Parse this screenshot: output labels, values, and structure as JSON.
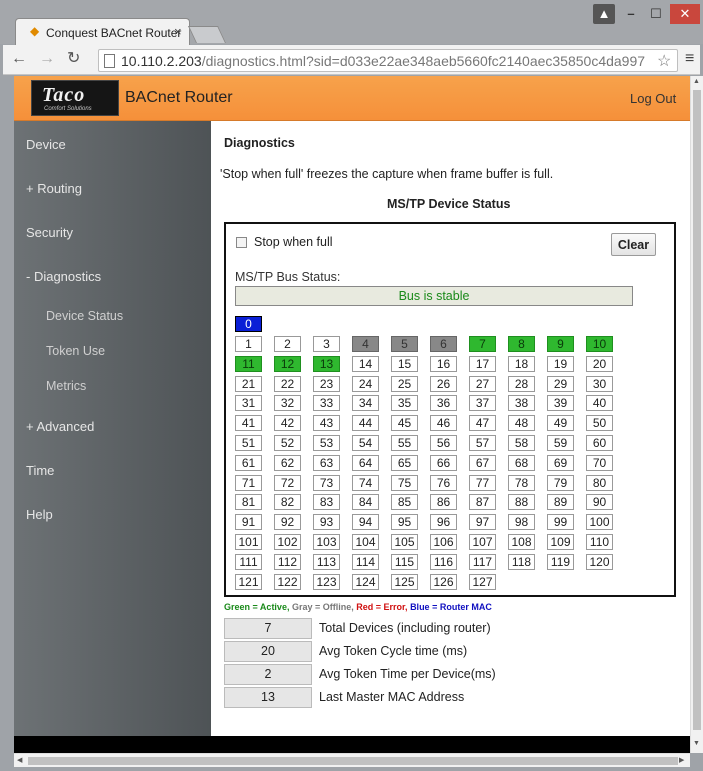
{
  "browser": {
    "tab_title": "Conquest BACnet Router",
    "tab_close": "×",
    "url_host": "10.110.2.203",
    "url_path": "/diagnostics.html?sid=d033e22ae348aeb5660fc2140aec35850c4da997"
  },
  "header": {
    "logo_text": "Taco",
    "logo_tagline": "Comfort Solutions",
    "app_title": "BACnet Router",
    "logout": "Log Out"
  },
  "sidebar": {
    "items": [
      {
        "label": "Device"
      },
      {
        "label": "+ Routing"
      },
      {
        "label": "Security"
      },
      {
        "label": "- Diagnostics"
      },
      {
        "label": "Device Status"
      },
      {
        "label": "Token Use"
      },
      {
        "label": "Metrics"
      },
      {
        "label": "+ Advanced"
      },
      {
        "label": "Time"
      },
      {
        "label": "Help"
      }
    ]
  },
  "main": {
    "heading": "Diagnostics",
    "note": "'Stop when full' freezes the capture when frame buffer is full.",
    "status_heading": "MS/TP Device Status",
    "stop_label": "Stop when full",
    "clear_label": "Clear",
    "bus_label": "MS/TP Bus Status:",
    "bus_status": "Bus is stable",
    "router_mac": 0,
    "active_macs": [
      7,
      8,
      9,
      10,
      11,
      12,
      13
    ],
    "offline_macs": [
      4,
      5,
      6
    ],
    "max_mac": 127,
    "legend": {
      "green": "Green = Active,",
      "gray": "Gray = Offline,",
      "red": "Red = Error,",
      "blue": "Blue = Router MAC"
    },
    "stats": [
      {
        "value": "7",
        "label": "Total Devices (including router)"
      },
      {
        "value": "20",
        "label": "Avg Token Cycle time (ms)"
      },
      {
        "value": "2",
        "label": "Avg Token Time per Device(ms)"
      },
      {
        "value": "13",
        "label": "Last Master MAC Address"
      }
    ]
  }
}
